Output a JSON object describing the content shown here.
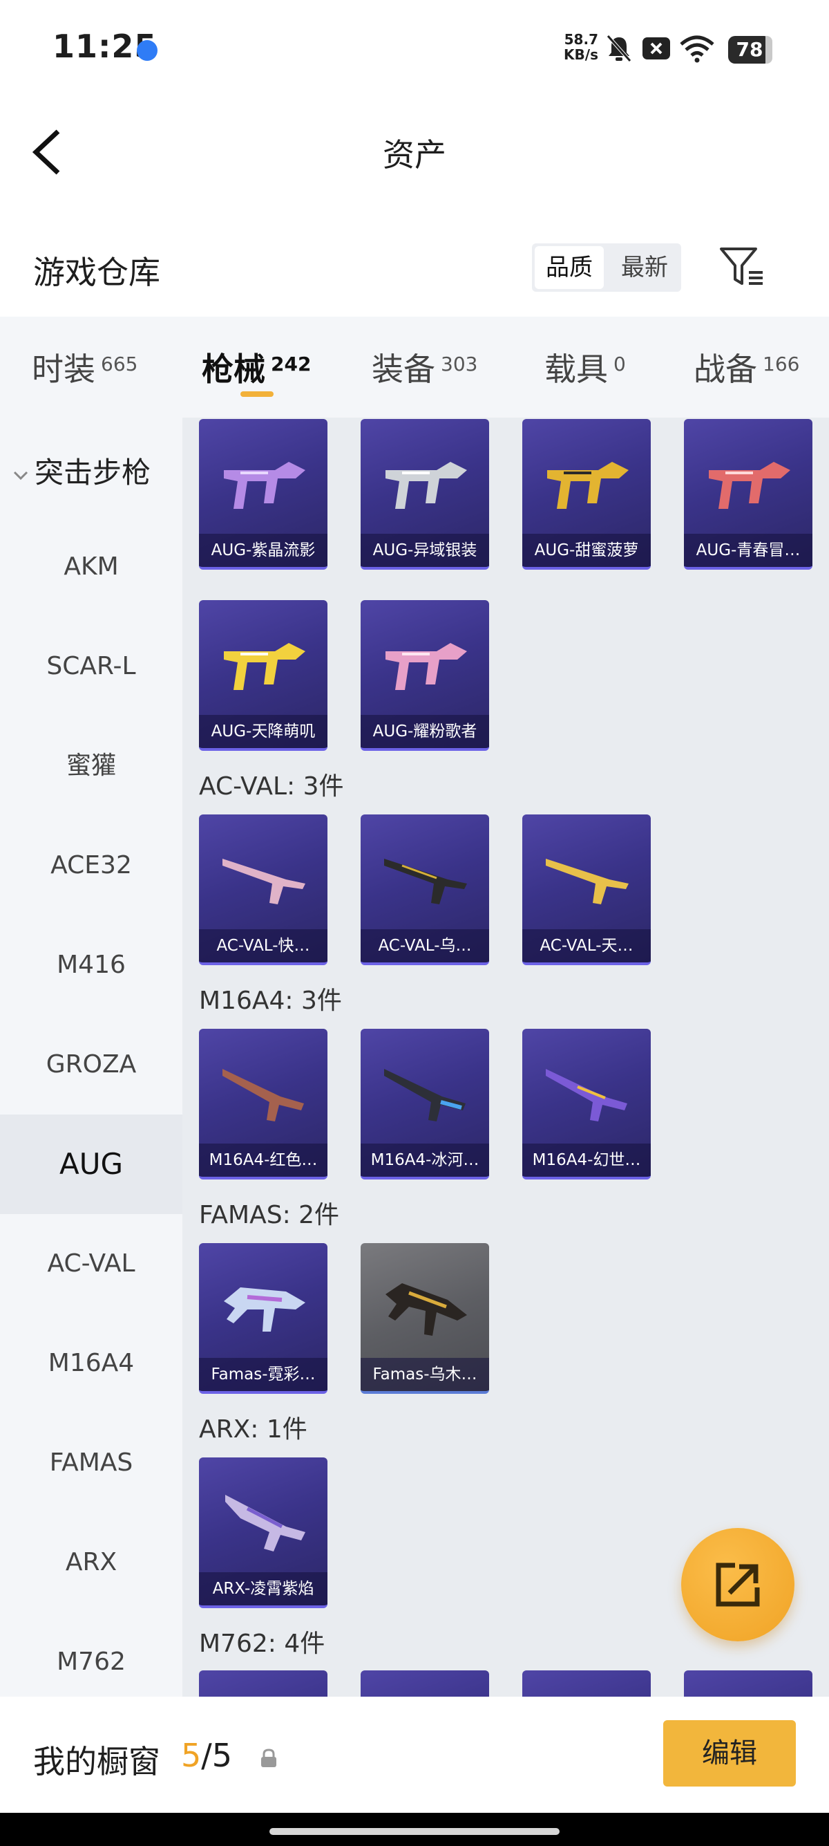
{
  "status_bar": {
    "time": "11:25",
    "speed_value": "58.7",
    "speed_unit": "KB/s",
    "battery": "78"
  },
  "header": {
    "title": "资产"
  },
  "warehouse": {
    "label": "游戏仓库",
    "sort_options": [
      "品质",
      "最新"
    ],
    "active_sort": "品质"
  },
  "tabs": [
    {
      "label": "时装",
      "count": "665"
    },
    {
      "label": "枪械",
      "count": "242"
    },
    {
      "label": "装备",
      "count": "303"
    },
    {
      "label": "载具",
      "count": "0"
    },
    {
      "label": "战备",
      "count": "166"
    }
  ],
  "active_tab": "枪械",
  "sidebar": {
    "category": "突击步枪",
    "items": [
      "AKM",
      "SCAR-L",
      "蜜獾",
      "ACE32",
      "M416",
      "GROZA",
      "AUG",
      "AC-VAL",
      "M16A4",
      "FAMAS",
      "ARX",
      "M762"
    ],
    "active_item": "AUG"
  },
  "sections": {
    "aug_items": [
      "AUG-紫晶流影",
      "AUG-异域银装",
      "AUG-甜蜜菠萝",
      "AUG-青春冒…",
      "AUG-天降萌叽",
      "AUG-耀粉歌者"
    ],
    "acval": {
      "title": "AC-VAL: 3件",
      "items": [
        "AC-VAL-快…",
        "AC-VAL-乌…",
        "AC-VAL-天…"
      ]
    },
    "m16a4": {
      "title": "M16A4: 3件",
      "items": [
        "M16A4-红色…",
        "M16A4-冰河…",
        "M16A4-幻世…"
      ]
    },
    "famas": {
      "title": "FAMAS: 2件",
      "items": [
        "Famas-霓彩…",
        "Famas-乌木…"
      ]
    },
    "arx": {
      "title": "ARX: 1件",
      "items": [
        "ARX-凌霄紫焰"
      ]
    },
    "m762": {
      "title": "M762: 4件"
    }
  },
  "bottom": {
    "label": "我的橱窗",
    "current": "5",
    "total": "5",
    "edit_label": "编辑"
  },
  "colors": {
    "accent": "#f2b63c",
    "card_purple": "#3a3389",
    "card_grey": "#5d5e63"
  }
}
